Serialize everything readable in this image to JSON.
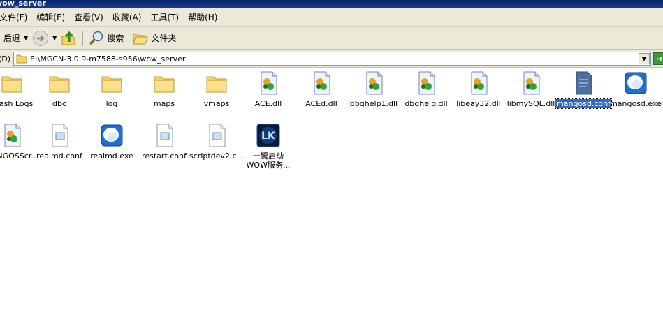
{
  "window": {
    "title": "wow_server"
  },
  "menu": [
    "文件(F)",
    "编辑(E)",
    "查看(V)",
    "收藏(A)",
    "工具(T)",
    "帮助(H)"
  ],
  "toolbar": {
    "back_label": "后退",
    "search_label": "搜索",
    "folders_label": "文件夹"
  },
  "address": {
    "label": "(D)",
    "path": "E:\\MGCN-3.0.9-m7588-s956\\wow_server"
  },
  "files": [
    {
      "name": "Crash Logs",
      "type": "folder"
    },
    {
      "name": "dbc",
      "type": "folder"
    },
    {
      "name": "log",
      "type": "folder"
    },
    {
      "name": "maps",
      "type": "folder"
    },
    {
      "name": "vmaps",
      "type": "folder"
    },
    {
      "name": "ACE.dll",
      "type": "dll"
    },
    {
      "name": "ACEd.dll",
      "type": "dll"
    },
    {
      "name": "dbghelp1.dll",
      "type": "dll"
    },
    {
      "name": "dbghelp.dll",
      "type": "dll"
    },
    {
      "name": "libeay32.dll",
      "type": "dll"
    },
    {
      "name": "libmySQL.dll",
      "type": "dll"
    },
    {
      "name": "mangosd.conf",
      "type": "conf",
      "selected": true
    },
    {
      "name": "mangosd.exe",
      "type": "exe"
    },
    {
      "name": "MaNGOSScr...",
      "type": "dll"
    },
    {
      "name": "realmd.conf",
      "type": "doc"
    },
    {
      "name": "realmd.exe",
      "type": "exe"
    },
    {
      "name": "restart.conf",
      "type": "doc"
    },
    {
      "name": "scriptdev2.c...",
      "type": "doc"
    },
    {
      "name": "一键启动WOW服务...",
      "type": "lk"
    }
  ]
}
